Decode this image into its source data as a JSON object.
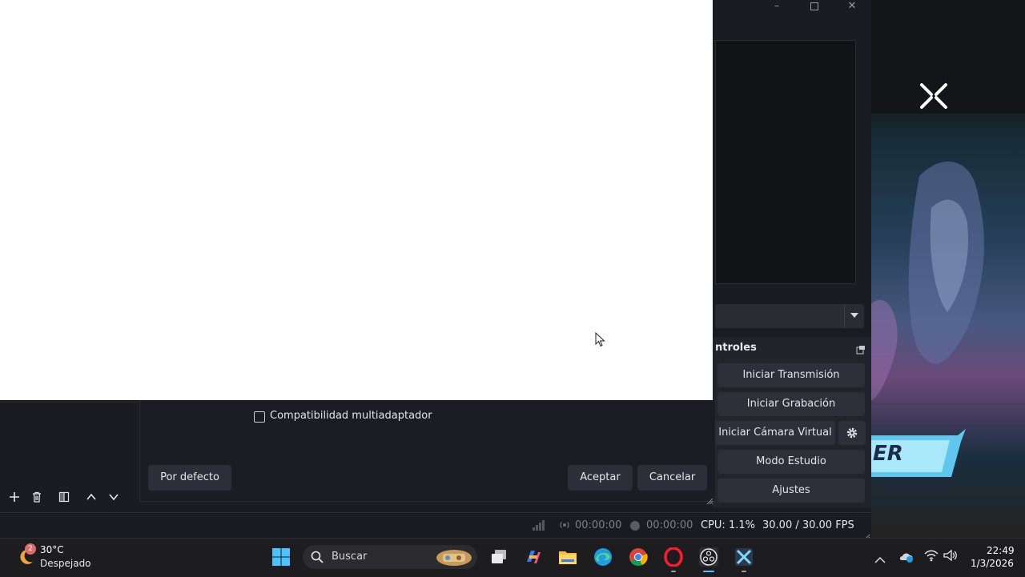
{
  "settings_dialog": {
    "checkbox_label": "Compatibilidad multiadaptador",
    "defaults_button": "Por defecto",
    "accept_button": "Aceptar",
    "cancel_button": "Cancelar"
  },
  "controls_dock": {
    "title": "ntroles",
    "buttons": {
      "start_stream": "Iniciar Transmisión",
      "start_record": "Iniciar Grabación",
      "start_virtual_cam": "Iniciar Cámara Virtual",
      "studio_mode": "Modo Estudio",
      "settings": "Ajustes"
    }
  },
  "status_bar": {
    "stream_time": "00:00:00",
    "record_time": "00:00:00",
    "cpu": "CPU: 1.1%",
    "fps": "30.00 / 30.00 FPS"
  },
  "game_art": {
    "banner_text": "ER"
  },
  "taskbar": {
    "weather": {
      "badge": "2",
      "temperature": "30°C",
      "condition": "Despejado"
    },
    "search_placeholder": "Buscar",
    "clock": {
      "time": "22:49",
      "date": "1/3/2026"
    },
    "apps": [
      "start-icon",
      "search-icon",
      "task-view-icon",
      "copilot-icon",
      "file-explorer-icon",
      "edge-icon",
      "chrome-icon",
      "opera-icon",
      "obs-icon",
      "game-icon"
    ]
  },
  "colors": {
    "obs_background": "#1b1c22",
    "button_background": "#2e2f39",
    "taskbar_background": "#1d1d20"
  }
}
